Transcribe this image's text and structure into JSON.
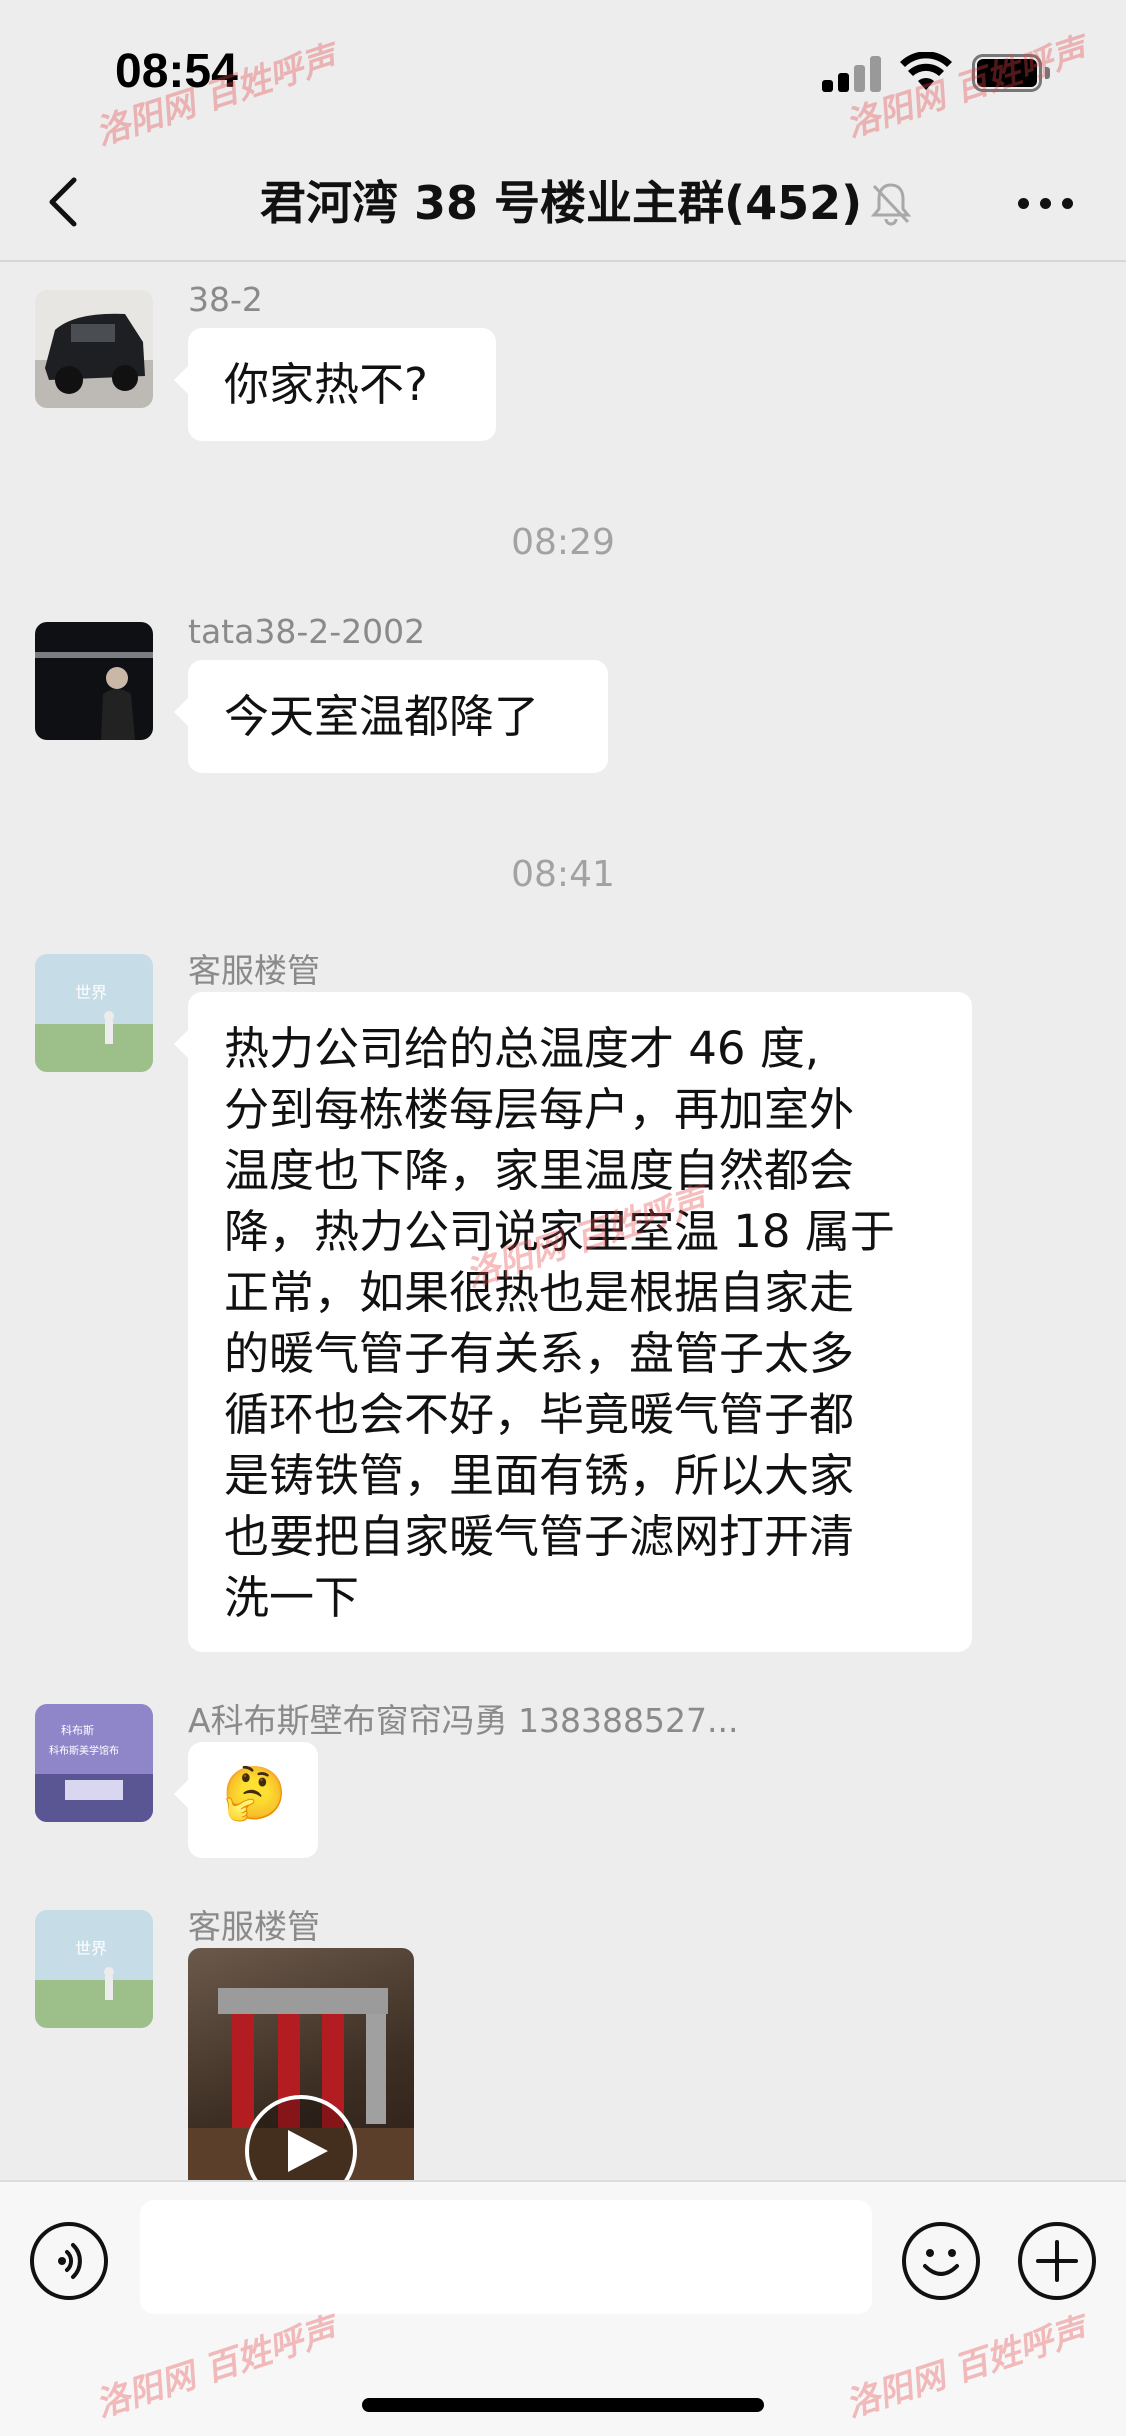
{
  "status_bar": {
    "time": "08:54"
  },
  "header": {
    "title": "君河湾 38 号楼业主群(452)",
    "icons": [
      "back-icon",
      "mute-bell-icon",
      "more-icon"
    ]
  },
  "messages": [
    {
      "sender": "38-2",
      "text": "你家热不?"
    },
    {
      "timestamp": "08:29"
    },
    {
      "sender": "tata38-2-2002",
      "text": "今天室温都降了"
    },
    {
      "timestamp": "08:41"
    },
    {
      "sender": "客服楼管",
      "lines": [
        "热力公司给的总温度才 46 度,",
        "分到每栋楼每层每户，再加室外",
        "温度也下降，家里温度自然都会",
        "降，热力公司说家里室温 18 属于",
        "正常，如果很热也是根据自家走",
        "的暖气管子有关系，盘管子太多",
        "循环也会不好，毕竟暖气管子都",
        "是铸铁管，里面有锈，所以大家",
        "也要把自家暖气管子滤网打开清",
        "洗一下"
      ]
    },
    {
      "sender": "A科布斯壁布窗帘冯勇 138388527...",
      "emoji": "🤔"
    },
    {
      "sender": "客服楼管",
      "media": "video"
    }
  ],
  "avatar_texts": {
    "world": "世界",
    "shop_line1": "科布斯",
    "shop_line2": "科布斯美学馆布"
  },
  "input_bar": {
    "placeholder": "",
    "icons": [
      "voice-icon",
      "emoji-icon",
      "plus-icon"
    ]
  },
  "watermark": {
    "text": "洛阳网 百姓呼声"
  },
  "colors": {
    "background": "#ededed",
    "bubble": "#ffffff",
    "meta_text": "#8a8a8a",
    "watermark": "#e64646"
  }
}
